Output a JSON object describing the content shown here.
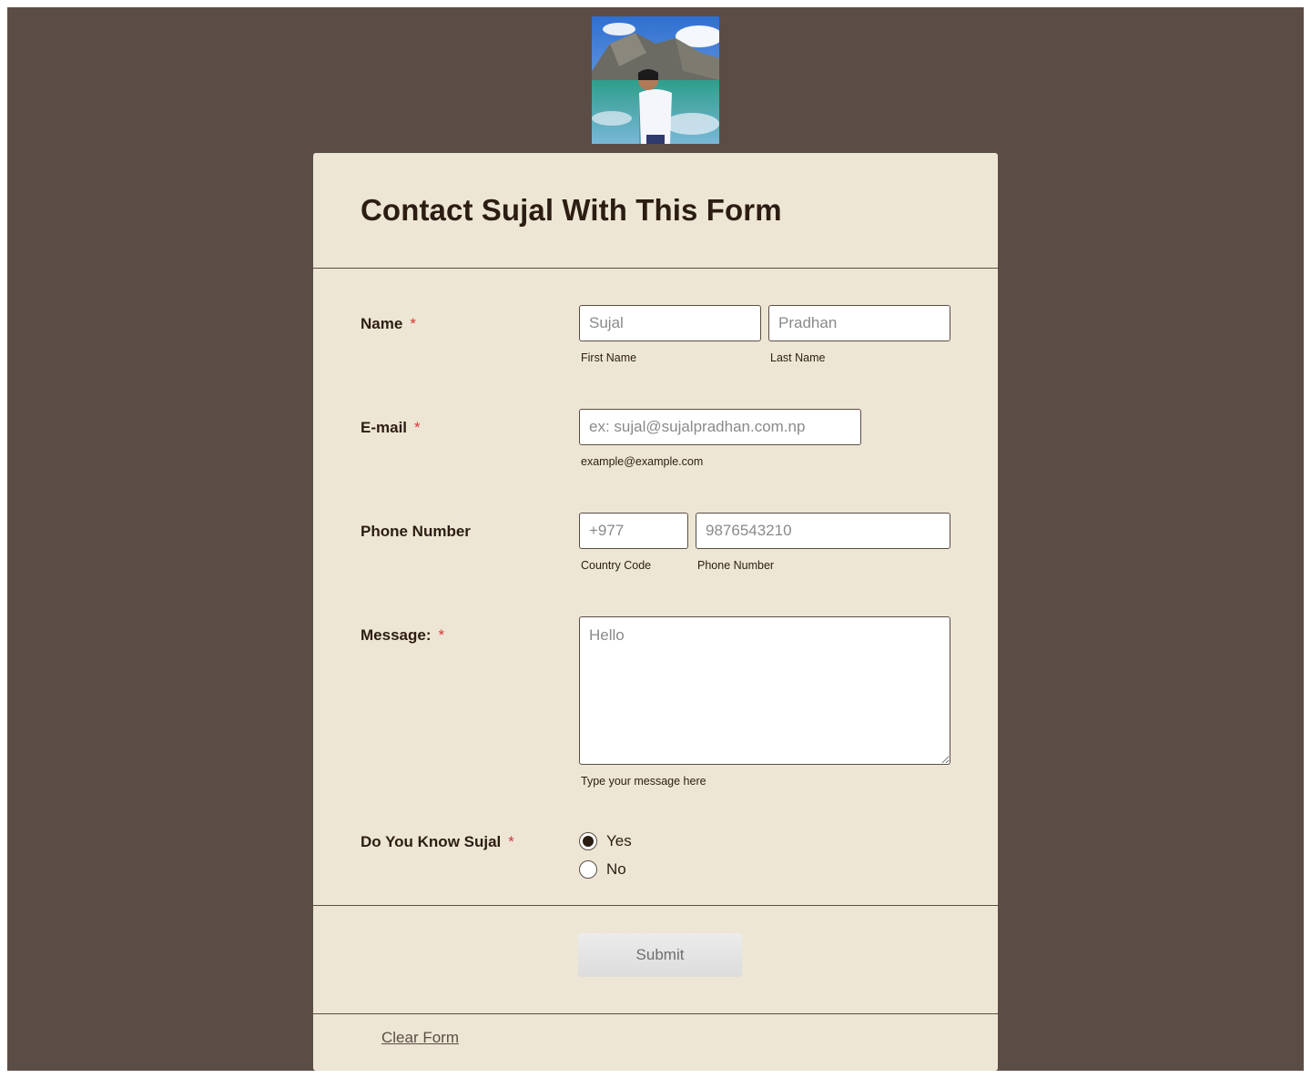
{
  "header": {
    "photo_alt": "Profile photo",
    "title": "Contact Sujal With This Form"
  },
  "fields": {
    "name": {
      "label": "Name",
      "required_mark": "*",
      "first_placeholder": "Sujal",
      "last_placeholder": "Pradhan",
      "first_sublabel": "First Name",
      "last_sublabel": "Last Name"
    },
    "email": {
      "label": "E-mail",
      "required_mark": "*",
      "placeholder": "ex: sujal@sujalpradhan.com.np",
      "sublabel": "example@example.com"
    },
    "phone": {
      "label": "Phone Number",
      "code_placeholder": "+977",
      "number_placeholder": "9876543210",
      "code_sublabel": "Country Code",
      "number_sublabel": "Phone Number"
    },
    "message": {
      "label": "Message:",
      "required_mark": "*",
      "placeholder": "Hello",
      "sublabel": "Type your message here"
    },
    "know_sujal": {
      "label": "Do You Know Sujal",
      "required_mark": "*",
      "options": [
        {
          "label": "Yes",
          "checked": true
        },
        {
          "label": "No",
          "checked": false
        }
      ]
    }
  },
  "actions": {
    "submit_label": "Submit",
    "clear_label": "Clear Form"
  },
  "colors": {
    "page_background": "#5b4d45",
    "card_background": "#eee6d5",
    "text": "#2c1d12",
    "required": "#d53737"
  }
}
